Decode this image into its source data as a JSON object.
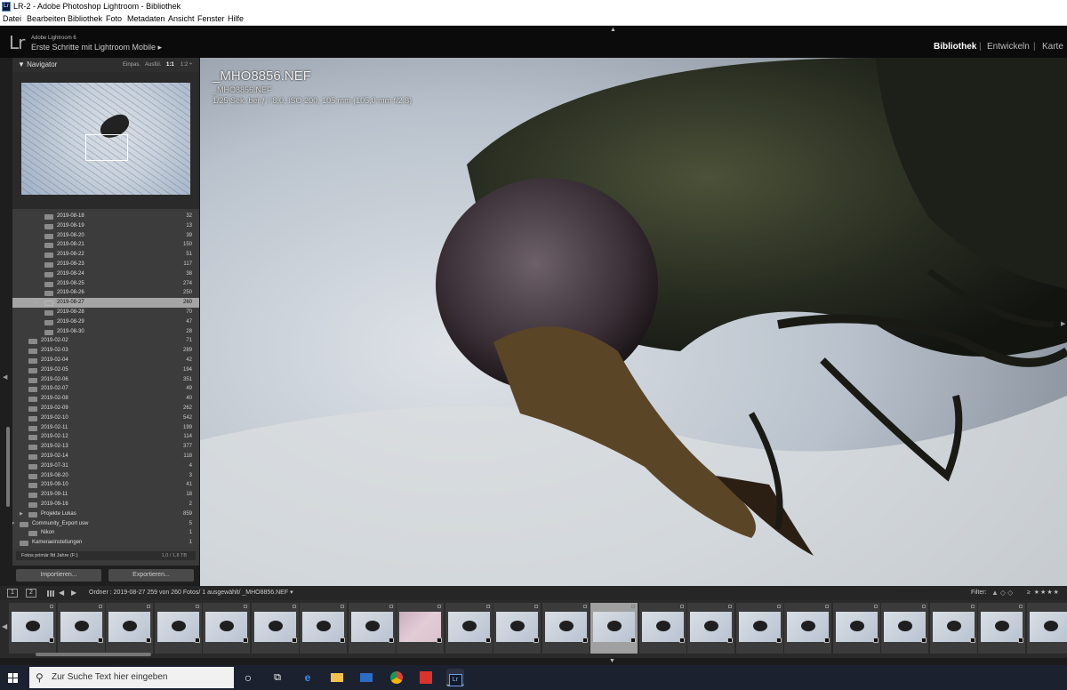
{
  "window": {
    "title": "LR-2 - Adobe Photoshop Lightroom - Bibliothek"
  },
  "menu": [
    "Datei",
    "Bearbeiten",
    "Bibliothek",
    "Foto",
    "Metadaten",
    "Ansicht",
    "Fenster",
    "Hilfe"
  ],
  "identity": {
    "logo": "Lr",
    "version": "Adobe Lightroom 6",
    "mobile": "Erste Schritte mit Lightroom Mobile ▸"
  },
  "modules": [
    "Bibliothek",
    "Entwickeln",
    "Karte"
  ],
  "navigator": {
    "title": "Navigator",
    "zoom": [
      "Einpas.",
      "Ausfül.",
      "1:1",
      "1:2 ÷"
    ]
  },
  "folders": [
    {
      "name": "2019-08-18",
      "count": "32",
      "level": 2
    },
    {
      "name": "2019-08-19",
      "count": "13",
      "level": 2
    },
    {
      "name": "2019-08-20",
      "count": "39",
      "level": 2
    },
    {
      "name": "2019-08-21",
      "count": "150",
      "level": 2
    },
    {
      "name": "2019-08-22",
      "count": "51",
      "level": 2
    },
    {
      "name": "2019-08-23",
      "count": "117",
      "level": 2
    },
    {
      "name": "2019-08-24",
      "count": "38",
      "level": 2
    },
    {
      "name": "2019-08-25",
      "count": "274",
      "level": 2
    },
    {
      "name": "2019-08-26",
      "count": "250",
      "level": 2
    },
    {
      "name": "2019-08-27",
      "count": "260",
      "level": 2,
      "selected": true
    },
    {
      "name": "2019-08-28",
      "count": "70",
      "level": 2
    },
    {
      "name": "2019-08-29",
      "count": "47",
      "level": 2
    },
    {
      "name": "2019-08-30",
      "count": "28",
      "level": 2
    },
    {
      "name": "2019-02-02",
      "count": "71",
      "level": 1
    },
    {
      "name": "2019-02-03",
      "count": "289",
      "level": 1
    },
    {
      "name": "2019-02-04",
      "count": "42",
      "level": 1
    },
    {
      "name": "2019-02-05",
      "count": "194",
      "level": 1
    },
    {
      "name": "2019-02-06",
      "count": "351",
      "level": 1
    },
    {
      "name": "2019-02-07",
      "count": "49",
      "level": 1
    },
    {
      "name": "2019-02-08",
      "count": "40",
      "level": 1
    },
    {
      "name": "2019-02-09",
      "count": "262",
      "level": 1
    },
    {
      "name": "2019-02-10",
      "count": "542",
      "level": 1
    },
    {
      "name": "2019-02-11",
      "count": "199",
      "level": 1
    },
    {
      "name": "2019-02-12",
      "count": "114",
      "level": 1
    },
    {
      "name": "2019-02-13",
      "count": "377",
      "level": 1
    },
    {
      "name": "2019-02-14",
      "count": "118",
      "level": 1
    },
    {
      "name": "2019-07-31",
      "count": "4",
      "level": 1
    },
    {
      "name": "2019-08-20",
      "count": "3",
      "level": 1
    },
    {
      "name": "2019-09-10",
      "count": "41",
      "level": 1
    },
    {
      "name": "2019-09-11",
      "count": "18",
      "level": 1
    },
    {
      "name": "2019-09-16",
      "count": "2",
      "level": 1
    },
    {
      "name": "Projekte Lukas",
      "count": "859",
      "level": 1,
      "expand": "▶"
    },
    {
      "name": "Community_Export usw",
      "count": "5",
      "level": 0,
      "expand": "▼"
    },
    {
      "name": "Nikon",
      "count": "1",
      "level": 1
    },
    {
      "name": "Kameraeinstellungen",
      "count": "1",
      "level": 0
    }
  ],
  "volume": {
    "name": "Fotos primär lfd Jahre (F:)",
    "size": "1,0 / 1,8 TB"
  },
  "buttons": {
    "import": "Importieren...",
    "export": "Exportieren..."
  },
  "photo_info": {
    "filename": "_MHO8856.NEF",
    "subname": "_MHO8856.NEF",
    "exif": "1/25 Sek. bei ƒ / 8,0, ISO 200, 105 mm (105,0 mm f/2.8)"
  },
  "filmbar": {
    "mon1": "1",
    "mon2": "2",
    "path": "Ordner : 2019-08-27    259 von 260 Fotos/ 1 ausgewählt/ _MHO8856.NEF ▾",
    "filter_label": "Filter:",
    "stars": "≥ ★★★★"
  },
  "filmstrip": {
    "count": 22,
    "selected_index": 12,
    "blurred_index": 8
  },
  "taskbar": {
    "search_placeholder": "Zur Suche Text hier eingeben",
    "pinned": [
      "cortana-icon",
      "task-view-icon",
      "edge-icon",
      "explorer-icon",
      "mail-icon",
      "chrome-icon",
      "acrobat-icon",
      "lightroom-icon"
    ]
  }
}
